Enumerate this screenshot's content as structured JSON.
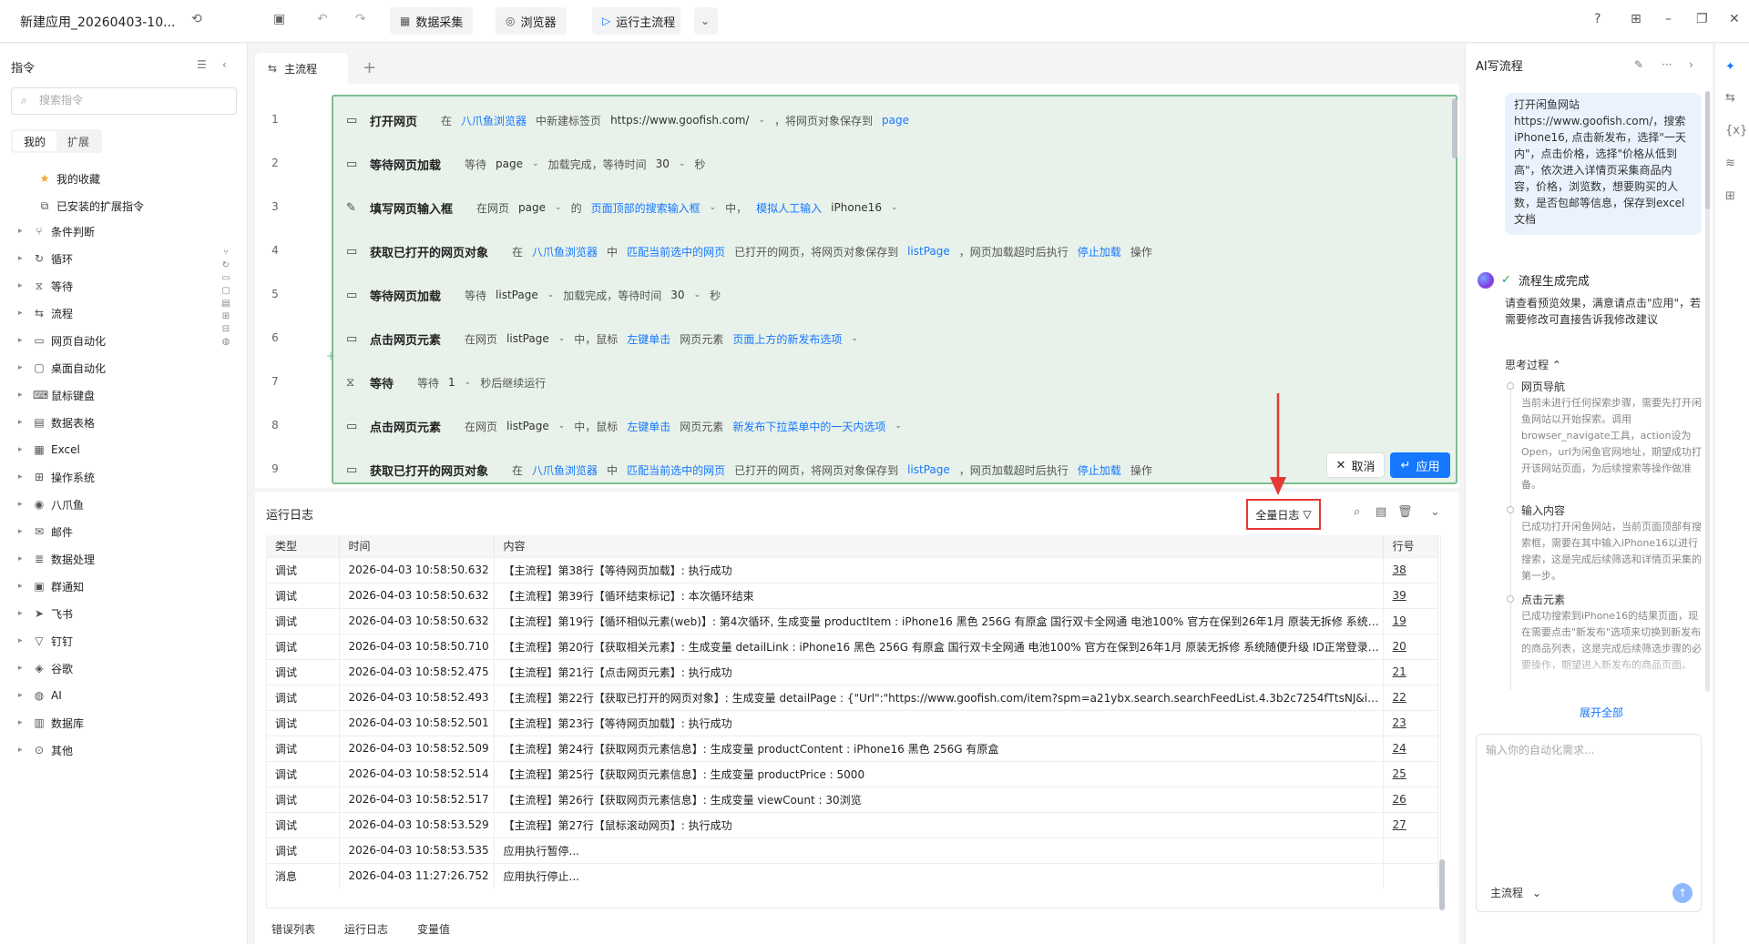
{
  "topbar": {
    "app_title": "新建应用_20260403-10...",
    "btn_data_collect": "数据采集",
    "btn_browser": "浏览器",
    "btn_run_main": "运行主流程"
  },
  "left": {
    "title": "指令",
    "search_placeholder": "搜索指令",
    "tab_mine": "我的",
    "tab_ext": "扩展",
    "fav": "我的收藏",
    "installed": "已安装的扩展指令",
    "tree": [
      "条件判断",
      "循环",
      "等待",
      "流程",
      "网页自动化",
      "桌面自动化",
      "鼠标键盘",
      "数据表格",
      "Excel",
      "操作系统",
      "八爪鱼",
      "邮件",
      "数据处理",
      "群通知",
      "飞书",
      "钉钉",
      "谷歌",
      "AI",
      "数据库",
      "其他"
    ]
  },
  "flow": {
    "tab": "主流程",
    "steps": [
      {
        "no": "1",
        "name": "打开网页",
        "parts": [
          {
            "t": "在"
          },
          {
            "t": "八爪鱼浏览器",
            "c": "link"
          },
          {
            "t": "中新建标签页"
          },
          {
            "t": "https://www.goofish.com/",
            "c": "var"
          },
          {
            "t": "⌄",
            "c": "dd"
          },
          {
            "t": "，将网页对象保存到"
          },
          {
            "t": "page",
            "c": "link"
          }
        ]
      },
      {
        "no": "2",
        "name": "等待网页加载",
        "parts": [
          {
            "t": "等待"
          },
          {
            "t": "page",
            "c": "var"
          },
          {
            "t": "⌄",
            "c": "dd"
          },
          {
            "t": "加载完成，等待时间"
          },
          {
            "t": "30",
            "c": "var"
          },
          {
            "t": "⌄",
            "c": "dd"
          },
          {
            "t": "秒"
          }
        ]
      },
      {
        "no": "3",
        "name": "填写网页输入框",
        "parts": [
          {
            "t": "在网页"
          },
          {
            "t": "page",
            "c": "var"
          },
          {
            "t": "⌄",
            "c": "dd"
          },
          {
            "t": "的"
          },
          {
            "t": "页面顶部的搜索输入框",
            "c": "link"
          },
          {
            "t": "⌄",
            "c": "dd"
          },
          {
            "t": "中，"
          },
          {
            "t": "模拟人工输入",
            "c": "link"
          },
          {
            "t": "iPhone16",
            "c": "var"
          },
          {
            "t": "⌄",
            "c": "dd"
          }
        ]
      },
      {
        "no": "4",
        "name": "获取已打开的网页对象",
        "parts": [
          {
            "t": "在"
          },
          {
            "t": "八爪鱼浏览器",
            "c": "link"
          },
          {
            "t": "中"
          },
          {
            "t": "匹配当前选中的网页",
            "c": "link"
          },
          {
            "t": "已打开的网页，将网页对象保存到"
          },
          {
            "t": "listPage",
            "c": "link"
          },
          {
            "t": "，网页加载超时后执行"
          },
          {
            "t": "停止加载",
            "c": "link"
          },
          {
            "t": "操作"
          }
        ]
      },
      {
        "no": "5",
        "name": "等待网页加载",
        "parts": [
          {
            "t": "等待"
          },
          {
            "t": "listPage",
            "c": "var"
          },
          {
            "t": "⌄",
            "c": "dd"
          },
          {
            "t": "加载完成，等待时间"
          },
          {
            "t": "30",
            "c": "var"
          },
          {
            "t": "⌄",
            "c": "dd"
          },
          {
            "t": "秒"
          }
        ]
      },
      {
        "no": "6",
        "name": "点击网页元素",
        "parts": [
          {
            "t": "在网页"
          },
          {
            "t": "listPage",
            "c": "var"
          },
          {
            "t": "⌄",
            "c": "dd"
          },
          {
            "t": "中，鼠标"
          },
          {
            "t": "左键单击",
            "c": "link"
          },
          {
            "t": "网页元素"
          },
          {
            "t": "页面上方的新发布选项",
            "c": "link"
          },
          {
            "t": "⌄",
            "c": "dd"
          }
        ]
      },
      {
        "no": "7",
        "name": "等待",
        "parts": [
          {
            "t": "等待"
          },
          {
            "t": "1",
            "c": "var"
          },
          {
            "t": "⌄",
            "c": "dd"
          },
          {
            "t": "秒后继续运行"
          }
        ]
      },
      {
        "no": "8",
        "name": "点击网页元素",
        "parts": [
          {
            "t": "在网页"
          },
          {
            "t": "listPage",
            "c": "var"
          },
          {
            "t": "⌄",
            "c": "dd"
          },
          {
            "t": "中，鼠标"
          },
          {
            "t": "左键单击",
            "c": "link"
          },
          {
            "t": "网页元素"
          },
          {
            "t": "新发布下拉菜单中的一天内选项",
            "c": "link"
          },
          {
            "t": "⌄",
            "c": "dd"
          }
        ]
      },
      {
        "no": "9",
        "name": "获取已打开的网页对象",
        "parts": [
          {
            "t": "在"
          },
          {
            "t": "八爪鱼浏览器",
            "c": "link"
          },
          {
            "t": "中"
          },
          {
            "t": "匹配当前选中的网页",
            "c": "link"
          },
          {
            "t": "已打开的网页，将网页对象保存到"
          },
          {
            "t": "listPage",
            "c": "link"
          },
          {
            "t": "，网页加载超时后执行"
          },
          {
            "t": "停止加载",
            "c": "link"
          },
          {
            "t": "操作"
          }
        ]
      }
    ],
    "cancel": "取消",
    "apply": "应用"
  },
  "log": {
    "title": "运行日志",
    "filter": "全量日志",
    "columns": [
      "类型",
      "时间",
      "内容",
      "行号"
    ],
    "rows": [
      [
        "调试",
        "2026-04-03 10:58:50.632",
        "【主流程】第38行【等待网页加载】: 执行成功",
        "38"
      ],
      [
        "调试",
        "2026-04-03 10:58:50.632",
        "【主流程】第39行【循环结束标记】: 本次循环结束",
        "39"
      ],
      [
        "调试",
        "2026-04-03 10:58:50.632",
        "【主流程】第19行【循环相似元素(web)】: 第4次循环, 生成变量 productItem : iPhone16 黑色 256G 有原盒 国行双卡全网通 电池100% 官方在保到26年1月 原装无拆修 系统随...",
        "19"
      ],
      [
        "调试",
        "2026-04-03 10:58:50.710",
        "【主流程】第20行【获取相关元素】: 生成变量 detailLink : iPhone16 黑色 256G 有原盒 国行双卡全网通 电池100% 官方在保到26年1月 原装无拆修 系统随便升级 ID正常登录退...",
        "20"
      ],
      [
        "调试",
        "2026-04-03 10:58:52.475",
        "【主流程】第21行【点击网页元素】: 执行成功",
        "21"
      ],
      [
        "调试",
        "2026-04-03 10:58:52.493",
        "【主流程】第22行【获取已打开的网页对象】: 生成变量 detailPage : {\"Url\":\"https://www.goofish.com/item?spm=a21ybx.search.searchFeedList.4.3b2c7254fTtsNJ&id=10...",
        "22"
      ],
      [
        "调试",
        "2026-04-03 10:58:52.501",
        "【主流程】第23行【等待网页加载】: 执行成功",
        "23"
      ],
      [
        "调试",
        "2026-04-03 10:58:52.509",
        "【主流程】第24行【获取网页元素信息】: 生成变量 productContent : iPhone16 黑色 256G 有原盒",
        "24"
      ],
      [
        "调试",
        "2026-04-03 10:58:52.514",
        "【主流程】第25行【获取网页元素信息】: 生成变量 productPrice : 5000",
        "25"
      ],
      [
        "调试",
        "2026-04-03 10:58:52.517",
        "【主流程】第26行【获取网页元素信息】: 生成变量 viewCount : 30浏览",
        "26"
      ],
      [
        "调试",
        "2026-04-03 10:58:53.529",
        "【主流程】第27行【鼠标滚动网页】: 执行成功",
        "27"
      ],
      [
        "调试",
        "2026-04-03 10:58:53.535",
        "应用执行暂停...",
        ""
      ],
      [
        "消息",
        "2026-04-03 11:27:26.752",
        "应用执行停止...",
        ""
      ]
    ],
    "bottom_tabs": [
      "错误列表",
      "运行日志",
      "变量值"
    ]
  },
  "ai": {
    "title": "AI写流程",
    "user_msg": "打开闲鱼网站https://www.goofish.com/，搜索iPhone16, 点击新发布，选择\"一天内\"，点击价格，选择\"价格从低到高\"，依次进入详情页采集商品内容，价格，浏览数，想要购买的人数，是否包邮等信息，保存到excel文档",
    "gen_done": "流程生成完成",
    "gen_note": "请查看预览效果，满意请点击\"应用\"，若需要修改可直接告诉我修改建议",
    "think": "思考过程",
    "steps": [
      {
        "name": "网页导航",
        "desc": "当前未进行任何探索步骤，需要先打开闲鱼网站以开始探索。调用browser_navigate工具，action设为Open，url为闲鱼官网地址，期望成功打开该网站页面，为后续搜索等操作做准备。"
      },
      {
        "name": "输入内容",
        "desc": "已成功打开闲鱼网站，当前页面顶部有搜索框，需要在其中输入iPhone16以进行搜索，这是完成后续筛选和详情页采集的第一步。"
      },
      {
        "name": "点击元素",
        "desc": "已成功搜索到iPhone16的结果页面，现在需要点击\"新发布\"选项来切换到新发布的商品列表，这是完成后续筛选步骤的必要操作，期望进入新发布的商品页面。"
      }
    ],
    "expand_all": "展开全部",
    "input_placeholder": "输入你的自动化需求...",
    "flow_select": "主流程"
  }
}
